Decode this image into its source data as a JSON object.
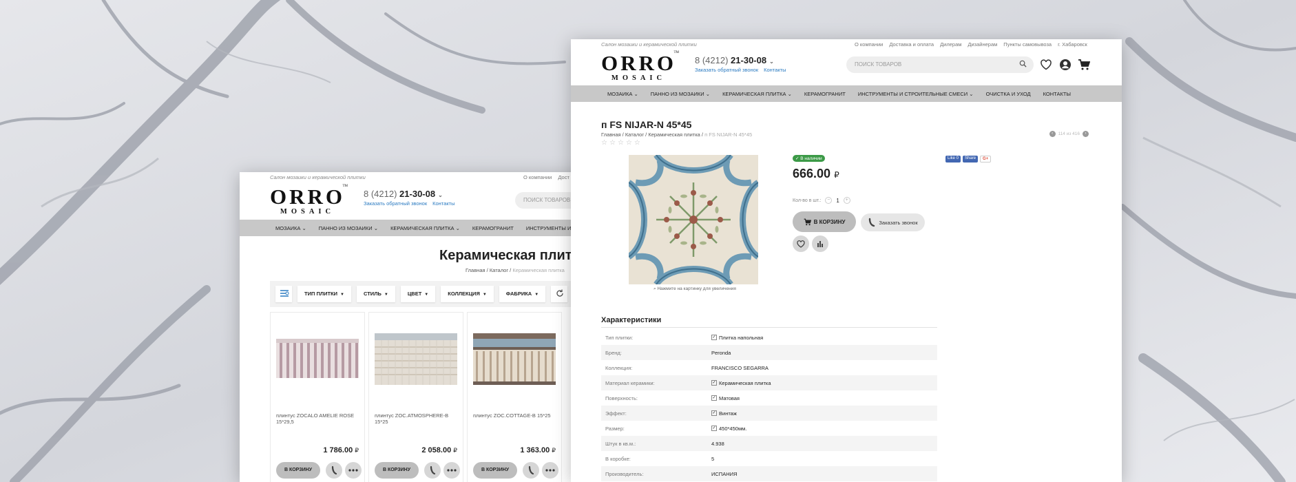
{
  "site": {
    "slogan": "Салон мозаики и керамической плитки",
    "top_links": [
      "О компании",
      "Доставка и оплата",
      "Дилерам",
      "Дизайнерам",
      "Пункты самовывоза",
      "г. Хабаровск"
    ],
    "logo_line1": "ORRO",
    "logo_line2": "MOSAIC",
    "logo_tm": "TM",
    "phone_code": "8 (4212)",
    "phone_number": "21-30-08",
    "callback_link": "Заказать обратный звонок",
    "contacts_link": "Контакты",
    "search_placeholder": "ПОИСК ТОВАРОВ",
    "nav": [
      "МОЗАИКА",
      "ПАННО ИЗ МОЗАИКИ",
      "КЕРАМИЧЕСКАЯ ПЛИТКА",
      "КЕРАМОГРАНИТ",
      "ИНСТРУМЕНТЫ И СТРОИТЕЛЬНЫЕ СМЕСИ",
      "ОЧИСТКА И УХОД",
      "КОНТАКТЫ"
    ]
  },
  "back": {
    "top_links": [
      "О компании",
      "Дост"
    ],
    "nav": [
      "МОЗАИКА",
      "ПАННО ИЗ МОЗАИКИ",
      "КЕРАМИЧЕСКАЯ ПЛИТКА",
      "КЕРАМОГРАНИТ",
      "ИНСТРУМЕНТЫ И СТ"
    ],
    "page_title": "Керамическая плит",
    "crumbs": {
      "home": "Главная",
      "catalog": "Каталог",
      "current": "Керамическая плитка"
    },
    "filters": [
      "ТИП ПЛИТКИ",
      "СТИЛЬ",
      "ЦВЕТ",
      "КОЛЛЕКЦИЯ",
      "ФАБРИКА"
    ],
    "cart_label": "В КОРЗИНУ",
    "products": [
      {
        "name": "плинтус ZOCALO AMELIE ROSE 15*29,5",
        "price": "1 786.00"
      },
      {
        "name": "плинтус ZOC.ATMOSPHERE-B 15*25",
        "price": "2 058.00"
      },
      {
        "name": "плинтус ZOC.COTTAGE-B 15*25",
        "price": "1 363.00"
      }
    ]
  },
  "product": {
    "title": "п FS NIJAR-N 45*45",
    "crumbs": {
      "home": "Главная",
      "catalog": "Каталог",
      "category": "Керамическая плитка",
      "current": "п FS NIJAR-N 45*45"
    },
    "pager_text": "114 из 416",
    "stock": "В наличии",
    "price": "666.00",
    "currency": "₽",
    "qty_label": "Кол-во в шт.:",
    "qty_value": "1",
    "cart_label": "В КОРЗИНУ",
    "call_label": "Заказать звонок",
    "zoom_note": "Нажмите на картинку для увеличения",
    "social": {
      "like": "Like 0",
      "share": "Share",
      "gplus": "G+"
    },
    "chars_title": "Характеристики",
    "chars": [
      {
        "k": "Тип плитки:",
        "v": "Плитка напольная",
        "check": true
      },
      {
        "k": "Бренд:",
        "v": "Peronda",
        "check": false
      },
      {
        "k": "Коллекция:",
        "v": "FRANCISCO SEGARRA",
        "check": false
      },
      {
        "k": "Материал керамики:",
        "v": "Керамическая плитка",
        "check": true
      },
      {
        "k": "Поверхность:",
        "v": "Матовая",
        "check": true
      },
      {
        "k": "Эффект:",
        "v": "Винтаж",
        "check": true
      },
      {
        "k": "Размер:",
        "v": "450*450мм.",
        "check": true
      },
      {
        "k": "Штук в кв.м.:",
        "v": "4.938",
        "check": false
      },
      {
        "k": "В коробке:",
        "v": "5",
        "check": false
      },
      {
        "k": "Производитель:",
        "v": "ИСПАНИЯ",
        "check": false
      }
    ]
  },
  "colors": {
    "accent_link": "#2a7ac1",
    "nav_bg": "#c8c8c8",
    "stock_green": "#3c9a47",
    "button_gray": "#bdbdbd"
  },
  "icons": [
    "search-icon",
    "heart-icon",
    "user-icon",
    "cart-icon",
    "filter-icon",
    "reset-icon",
    "phone-icon",
    "compare-icon",
    "more-icon",
    "star-icon",
    "zoom-icon"
  ]
}
